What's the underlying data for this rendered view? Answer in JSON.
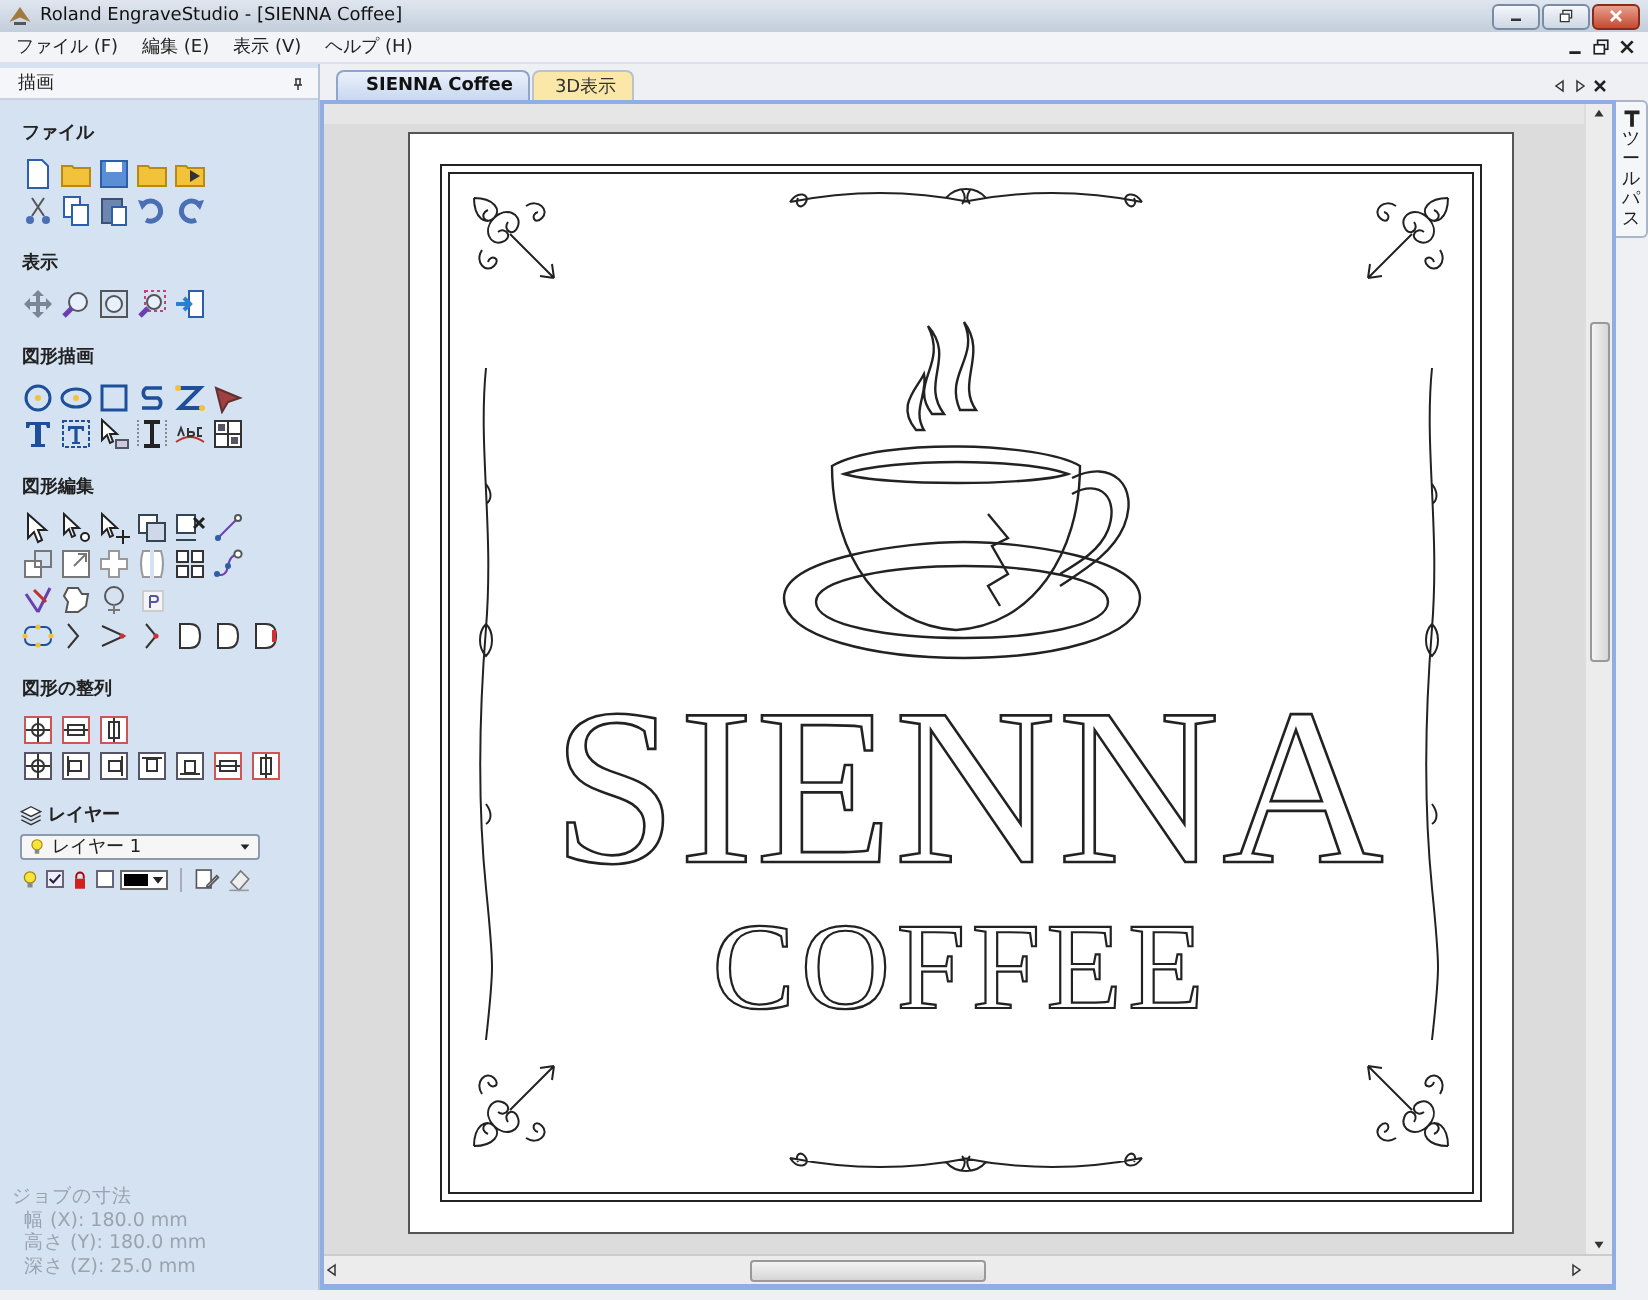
{
  "window": {
    "title": "Roland EngraveStudio - [SIENNA Coffee]"
  },
  "menu": [
    {
      "label": "ファイル (F)"
    },
    {
      "label": "編集 (E)"
    },
    {
      "label": "表示 (V)"
    },
    {
      "label": "ヘルプ (H)"
    }
  ],
  "panel": {
    "title": "描画",
    "sections": [
      {
        "title": "ファイル"
      },
      {
        "title": "表示"
      },
      {
        "title": "図形描画"
      },
      {
        "title": "図形編集"
      },
      {
        "title": "図形の整列"
      }
    ],
    "layer": {
      "title": "レイヤー",
      "value": "レイヤー 1",
      "visible": true,
      "locked": false
    },
    "job": {
      "title": "ジョブの寸法",
      "lines": [
        "幅 (X): 180.0 mm",
        "高さ (Y): 180.0 mm",
        "深さ (Z): 25.0 mm"
      ]
    }
  },
  "tabs": [
    {
      "label": "SIENNA Coffee",
      "selected": true
    },
    {
      "label": "3D表示",
      "selected": false
    }
  ],
  "side_tab": {
    "label": "ツールパス"
  },
  "canvas": {
    "title": "SIENNA",
    "subtitle": "COFFEE"
  }
}
